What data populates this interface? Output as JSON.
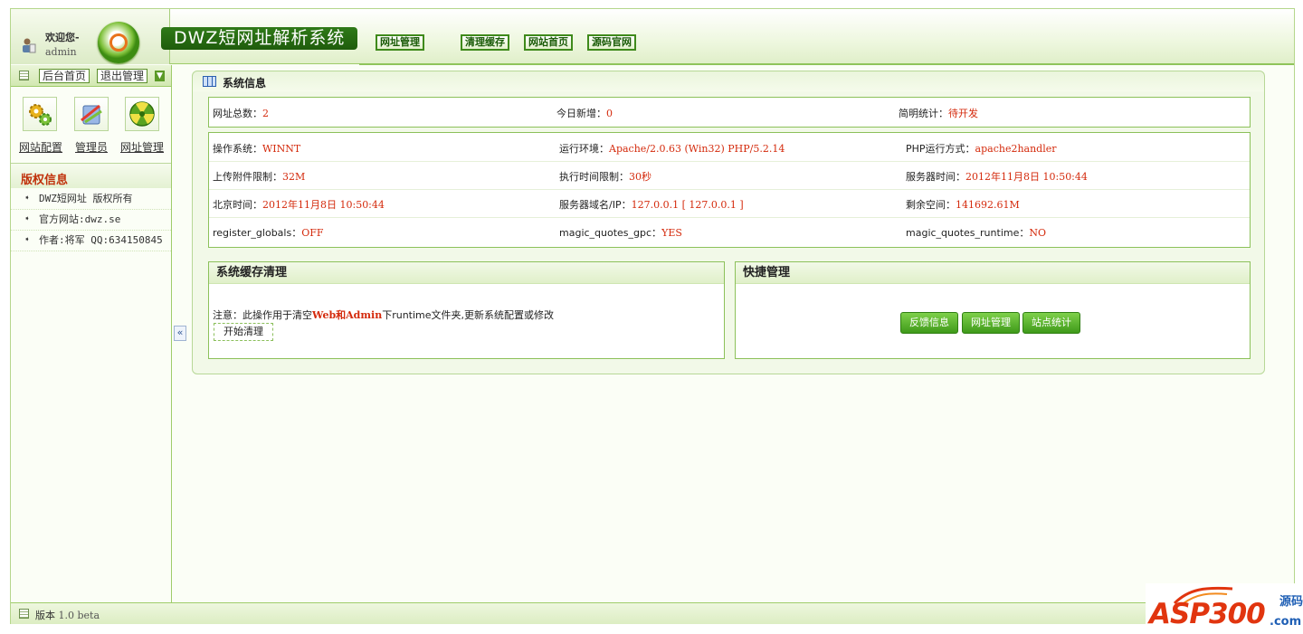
{
  "header": {
    "welcome": "欢迎您-",
    "username": "admin",
    "brand": "DWZ短网址解析系统",
    "nav": [
      "网址管理",
      "清理缓存",
      "网站首页",
      "源码官网"
    ]
  },
  "sidebar": {
    "buttons": [
      "后台首页",
      "退出管理"
    ],
    "quick_links": [
      "网站配置",
      "管理员",
      "网址管理"
    ],
    "section_title": "版权信息",
    "items": [
      "DWZ短网址 版权所有",
      "官方网站:dwz.se",
      "作者:将军 QQ:634150845"
    ]
  },
  "main": {
    "title": "系统信息",
    "summary": [
      {
        "label": "网址总数：",
        "value": "2"
      },
      {
        "label": "今日新增：",
        "value": "0"
      },
      {
        "label": "简明统计：",
        "value": "待开发"
      }
    ],
    "info_rows": [
      [
        {
          "label": "操作系统：",
          "value": "WINNT"
        },
        {
          "label": "运行环境：",
          "value": "Apache/2.0.63 (Win32) PHP/5.2.14"
        },
        {
          "label": "PHP运行方式：",
          "value": "apache2handler"
        }
      ],
      [
        {
          "label": "上传附件限制：",
          "value": "32M"
        },
        {
          "label": "执行时间限制：",
          "value": "30秒"
        },
        {
          "label": "服务器时间：",
          "value": "2012年11月8日 10:50:44"
        }
      ],
      [
        {
          "label": "北京时间：",
          "value": "2012年11月8日 10:50:44"
        },
        {
          "label": "服务器域名/IP：",
          "value": "127.0.0.1 [ 127.0.0.1 ]"
        },
        {
          "label": "剩余空间：",
          "value": "141692.61M"
        }
      ],
      [
        {
          "label": "register_globals：",
          "value": "OFF"
        },
        {
          "label": "magic_quotes_gpc：",
          "value": "YES"
        },
        {
          "label": "magic_quotes_runtime：",
          "value": "NO"
        }
      ]
    ],
    "cache_panel": {
      "title": "系统缓存清理",
      "note_prefix": "注意：此操作用于清空",
      "note_bold": "Web和Admin",
      "note_suffix": "下runtime文件夹,更新系统配置或修改",
      "button": "开始清理"
    },
    "quick_panel": {
      "title": "快捷管理",
      "buttons": [
        "反馈信息",
        "网址管理",
        "站点统计"
      ]
    }
  },
  "footer": {
    "label": "版本",
    "version": "1.0 beta"
  },
  "watermark": {
    "brand": "ASP300",
    "suffix": "源码",
    "tld": ".com"
  },
  "colors": {
    "accent_green": "#3f8a1b",
    "value_red": "#d42a0c",
    "border_green": "#8cc15a"
  }
}
